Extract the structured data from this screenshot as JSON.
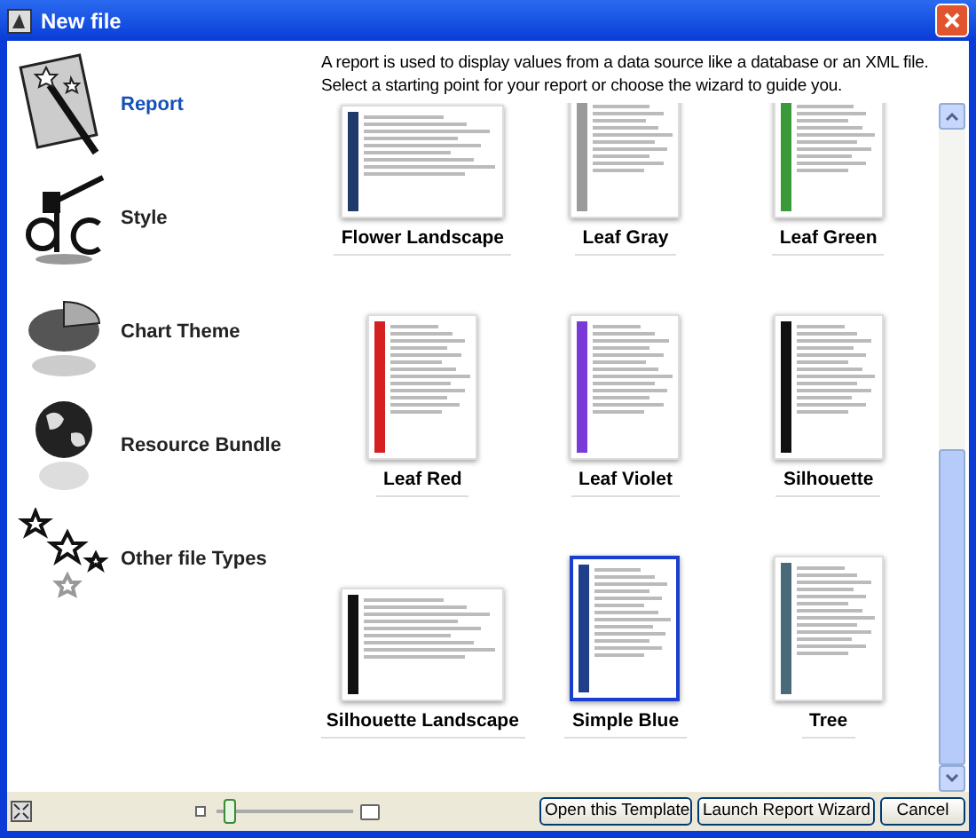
{
  "window": {
    "title": "New file"
  },
  "sidebar": {
    "items": [
      {
        "label": "Report",
        "kind": "report",
        "selected": true
      },
      {
        "label": "Style",
        "kind": "style",
        "selected": false
      },
      {
        "label": "Chart Theme",
        "kind": "chart",
        "selected": false
      },
      {
        "label": "Resource Bundle",
        "kind": "globe",
        "selected": false
      },
      {
        "label": "Other file Types",
        "kind": "stars",
        "selected": false
      }
    ]
  },
  "description": [
    "A report is used to display values from a data source like a database or an XML file.",
    "Select a starting point for your report or choose the wizard to guide you."
  ],
  "templates": [
    {
      "label": "Flower Landscape",
      "kind": "landscape",
      "color": "#1f3a6b",
      "selected": false
    },
    {
      "label": "Leaf Gray",
      "kind": "portrait",
      "color": "#9a9a9a",
      "selected": false
    },
    {
      "label": "Leaf Green",
      "kind": "portrait",
      "color": "#3a9a3a",
      "selected": false
    },
    {
      "label": "Leaf Red",
      "kind": "portrait",
      "color": "#d42020",
      "selected": false
    },
    {
      "label": "Leaf Violet",
      "kind": "portrait",
      "color": "#7a3ad8",
      "selected": false
    },
    {
      "label": "Silhouette",
      "kind": "portrait",
      "color": "#111111",
      "selected": false
    },
    {
      "label": "Silhouette Landscape",
      "kind": "landscape",
      "color": "#111111",
      "selected": false
    },
    {
      "label": "Simple Blue",
      "kind": "portrait",
      "color": "#1f3f8a",
      "selected": true
    },
    {
      "label": "Tree",
      "kind": "portrait",
      "color": "#4a6a7a",
      "selected": false
    }
  ],
  "zoom_slider": {
    "level": 0.05
  },
  "buttons": [
    {
      "label": "Open this Template"
    },
    {
      "label": "Launch Report Wizard"
    },
    {
      "label": "Cancel"
    }
  ]
}
